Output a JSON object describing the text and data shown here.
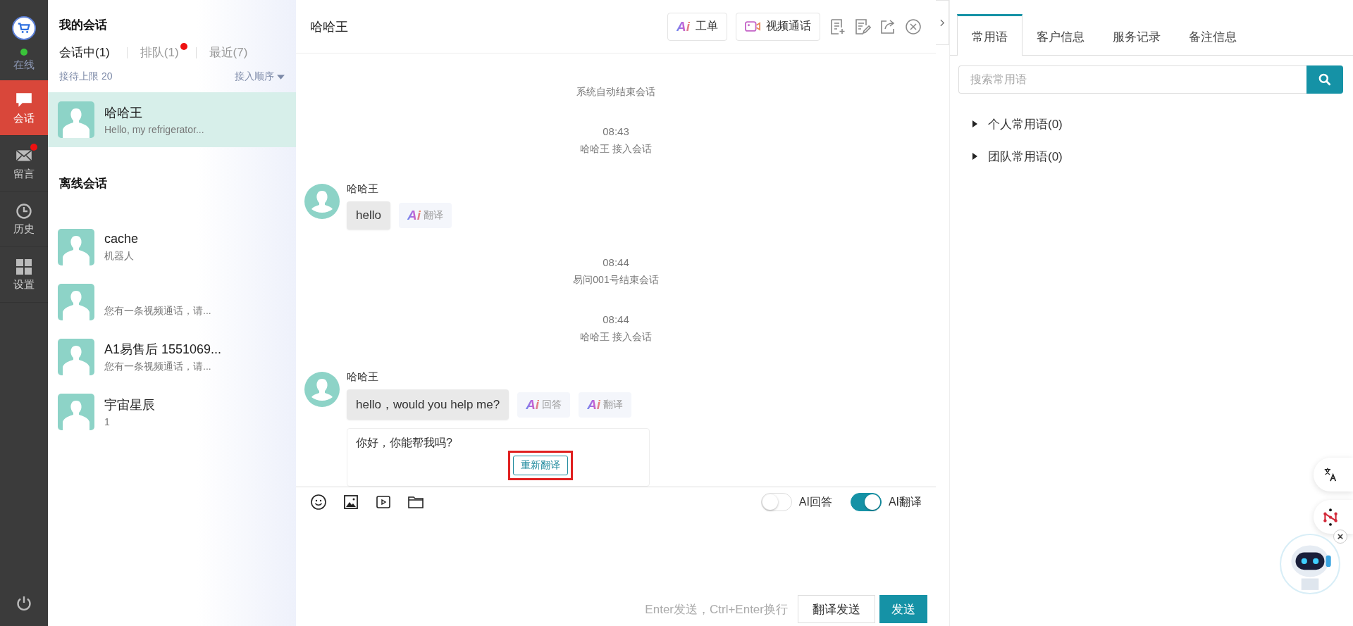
{
  "nav": {
    "status": {
      "label": "在线",
      "online": true
    },
    "items": [
      {
        "label": "会话",
        "kind": "chat",
        "selected": true,
        "badge": false
      },
      {
        "label": "留言",
        "kind": "mail",
        "selected": false,
        "badge": true
      },
      {
        "label": "历史",
        "kind": "clock",
        "selected": false,
        "badge": false
      },
      {
        "label": "设置",
        "kind": "grid",
        "selected": false,
        "badge": false
      }
    ]
  },
  "conversations": {
    "title": "我的会话",
    "tabs": [
      {
        "label": "会话中(1)",
        "selected": true,
        "badge": false
      },
      {
        "label": "排队(1)",
        "selected": false,
        "badge": true
      },
      {
        "label": "最近(7)",
        "selected": false,
        "badge": false
      }
    ],
    "limit": "接待上限 20",
    "sort": "接入顺序",
    "active": [
      {
        "name": "哈哈王",
        "preview": "Hello, my refrigerator...",
        "selected": true
      }
    ],
    "offline_title": "离线会话",
    "offline": [
      {
        "name": "cache",
        "preview": "机器人",
        "selected": false
      },
      {
        "preview": "您有一条视频通话，请...",
        "selected": false
      },
      {
        "name": "A1易售后 1551069...",
        "preview": "您有一条视频通话，请...",
        "selected": false
      },
      {
        "name": "宇宙星辰",
        "preview": "1",
        "selected": false
      }
    ]
  },
  "chat": {
    "title": "哈哈王",
    "header_buttons": [
      {
        "kind": "ai",
        "logo": "Ai",
        "label": "工单"
      },
      {
        "kind": "video",
        "label": "视频通话"
      }
    ],
    "messages": [
      {
        "kind": "system",
        "text": "系统自动结束会话"
      },
      {
        "kind": "event",
        "time": "08:43",
        "text": "哈哈王 接入会话"
      },
      {
        "kind": "message",
        "sender": "哈哈王",
        "text": "hello",
        "actions": [
          {
            "logo": "Ai",
            "label": "翻译"
          }
        ]
      },
      {
        "kind": "event",
        "time": "08:44",
        "text": "易问001号结束会话"
      },
      {
        "kind": "event",
        "time": "08:44",
        "text": "哈哈王 接入会话"
      },
      {
        "kind": "message",
        "sender": "哈哈王",
        "text": "hello，would you help me?",
        "actions": [
          {
            "logo": "Ai",
            "label": "回答"
          },
          {
            "logo": "Ai",
            "label": "翻译"
          }
        ],
        "translation": {
          "text": "你好，你能帮我吗?",
          "button": "重新翻译",
          "highlighted": true
        }
      }
    ],
    "toggles": [
      {
        "label": "AI回答",
        "on": false
      },
      {
        "label": "AI翻译",
        "on": true
      }
    ],
    "hint": "Enter发送，Ctrl+Enter换行",
    "buttons": [
      {
        "label": "翻译发送",
        "primary": false
      },
      {
        "label": "发送",
        "primary": true
      }
    ]
  },
  "side": {
    "tabs": [
      {
        "label": "常用语",
        "selected": true
      },
      {
        "label": "客户信息",
        "selected": false
      },
      {
        "label": "服务记录",
        "selected": false
      },
      {
        "label": "备注信息",
        "selected": false
      }
    ],
    "search": {
      "placeholder": "搜索常用语"
    },
    "groups": [
      {
        "label": "个人常用语(0)",
        "expanded": false
      },
      {
        "label": "团队常用语(0)",
        "expanded": false
      }
    ]
  }
}
